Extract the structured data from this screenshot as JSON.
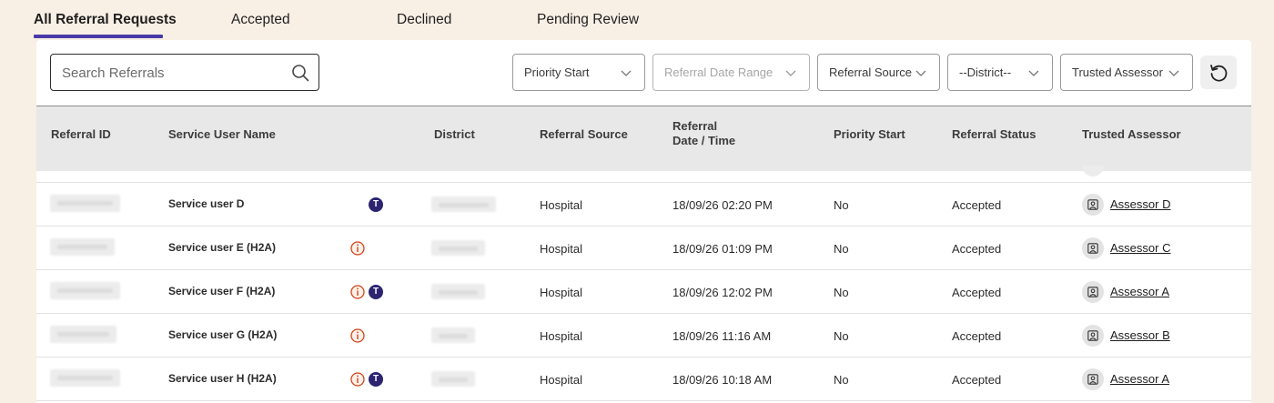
{
  "tabs": [
    {
      "label": "All Referral Requests",
      "active": true
    },
    {
      "label": "Accepted",
      "active": false
    },
    {
      "label": "Declined",
      "active": false
    },
    {
      "label": "Pending Review",
      "active": false
    }
  ],
  "search": {
    "placeholder": "Search Referrals",
    "value": ""
  },
  "filters": {
    "priority_start": "Priority Start",
    "date_range": "Referral Date Range",
    "referral_source": "Referral Source",
    "district": "--District--",
    "trusted_assessor": "Trusted Assessor"
  },
  "table": {
    "headers": {
      "referral_id": "Referral ID",
      "service_user_name": "Service User Name",
      "district": "District",
      "referral_source": "Referral Source",
      "referral_date_line1": "Referral",
      "referral_date_line2": "Date / Time",
      "priority_start": "Priority Start",
      "referral_status": "Referral Status",
      "trusted_assessor": "Trusted Assessor"
    },
    "rows": [
      {
        "name": "Service user D",
        "info_icon": false,
        "trusted_icon": true,
        "source": "Hospital",
        "datetime": "18/09/26 02:20 PM",
        "priority": "No",
        "status": "Accepted",
        "assessor": "Assessor D"
      },
      {
        "name": "Service user E (H2A)",
        "info_icon": true,
        "trusted_icon": false,
        "source": "Hospital",
        "datetime": "18/09/26 01:09 PM",
        "priority": "No",
        "status": "Accepted",
        "assessor": "Assessor C"
      },
      {
        "name": "Service user F (H2A)",
        "info_icon": true,
        "trusted_icon": true,
        "source": "Hospital",
        "datetime": "18/09/26 12:02 PM",
        "priority": "No",
        "status": "Accepted",
        "assessor": "Assessor A"
      },
      {
        "name": "Service user G (H2A)",
        "info_icon": true,
        "trusted_icon": false,
        "source": "Hospital",
        "datetime": "18/09/26 11:16 AM",
        "priority": "No",
        "status": "Accepted",
        "assessor": "Assessor B"
      },
      {
        "name": "Service user H (H2A)",
        "info_icon": true,
        "trusted_icon": true,
        "source": "Hospital",
        "datetime": "18/09/26 10:18 AM",
        "priority": "No",
        "status": "Accepted",
        "assessor": "Assessor A"
      }
    ]
  },
  "icons": {
    "trusted_glyph": "T",
    "info_glyph": "i"
  },
  "colors": {
    "accent": "#4a3aa8",
    "trusted_badge": "#2b2570",
    "info_red": "#d0451b",
    "background": "#f8efe5"
  }
}
